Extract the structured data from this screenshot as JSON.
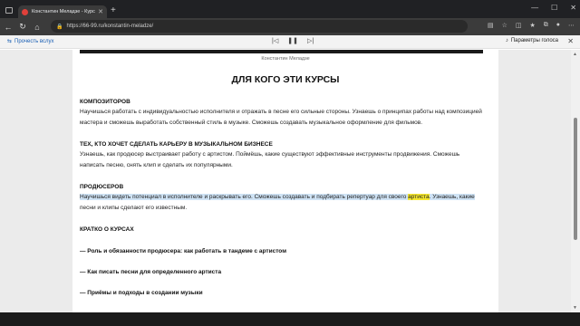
{
  "browser": {
    "tab_title": "Константин Меладзе - Курсы |",
    "url": "https://66-99.ru/konstantin-meladze/"
  },
  "reader": {
    "read_aloud": "Прочесть вслух",
    "voice_settings": "Параметры голоса"
  },
  "article": {
    "caption": "Константин Меладзе",
    "heading": "ДЛЯ КОГО ЭТИ КУРСЫ",
    "sections": [
      {
        "title": "КОМПОЗИТОРОВ",
        "line1": "Научишься работать с индивидуальностью исполнителя и отражать в песне его сильные стороны. Узнаешь о принципах работы над композицией",
        "line2": "мастера и сможешь выработать собственный стиль в музыке. Сможешь создавать музыкальное оформление для фильмов."
      },
      {
        "title": "ТЕХ, КТО ХОЧЕТ СДЕЛАТЬ КАРЬЕРУ В МУЗЫКАЛЬНОМ БИЗНЕСЕ",
        "line1": "Узнаешь, как продюсер выстраивает работу с артистом. Поймёшь, какие существуют эффективные инструменты продвижения. Сможешь",
        "line2": "написать песню, снять клип и сделать их популярными."
      },
      {
        "title": "ПРОДЮСЕРОВ",
        "line1_a": "Научишься видеть потенциал в исполнителе и раскрывать его. Сможешь создавать и подбирать репертуар для своего ",
        "line1_word": "артиста",
        "line1_b": ". Узнаешь, какие",
        "line2": "песни и клипы сделают его известным."
      }
    ],
    "brief_title": "КРАТКО О КУРСАХ",
    "bullets": [
      "— Роль и обязанности продюсера: как работать в тандеме с артистом",
      "— Как писать песни для определенного артиста",
      "— Приёмы и подходы в создании музыки"
    ]
  }
}
